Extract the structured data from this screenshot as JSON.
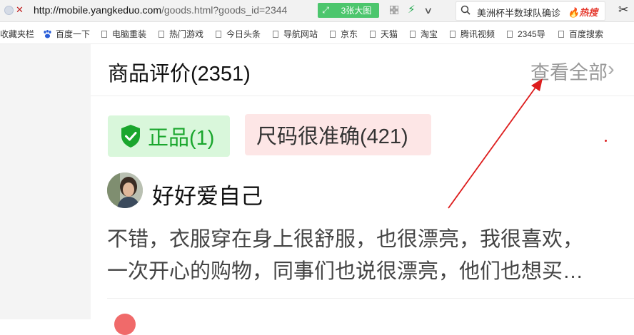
{
  "browser": {
    "url_host": "http://mobile.yangkeduo.com",
    "url_rest": "/goods.html?goods_id=2344",
    "picture_btn": "3张大图",
    "search_query": "美洲杯半数球队确诊",
    "search_hot": "热搜"
  },
  "bookmarks": [
    {
      "label": "收藏夹栏"
    },
    {
      "label": "百度一下"
    },
    {
      "label": "电脑重装"
    },
    {
      "label": "热门游戏"
    },
    {
      "label": "今日头条"
    },
    {
      "label": "导航网站"
    },
    {
      "label": "京东"
    },
    {
      "label": "天猫"
    },
    {
      "label": "淘宝"
    },
    {
      "label": "腾讯视频"
    },
    {
      "label": "2345导"
    },
    {
      "label": "百度搜索"
    }
  ],
  "reviews": {
    "title": "商品评价(2351)",
    "view_all": "查看全部",
    "tags": [
      {
        "label": "正品(1)",
        "color": "#1aa62d"
      },
      {
        "label": "尺码很准确(421)",
        "color": "#333333"
      }
    ],
    "item": {
      "username": "好好爱自己",
      "text_lines": [
        "不错，衣服穿在身上很舒服，也很漂亮，我很喜欢，",
        "一次开心的购物，同事们也说很漂亮，他们也想买…"
      ]
    }
  },
  "colors": {
    "accent_green": "#4cc66d",
    "annotation_arrow": "#dd1c1c"
  }
}
